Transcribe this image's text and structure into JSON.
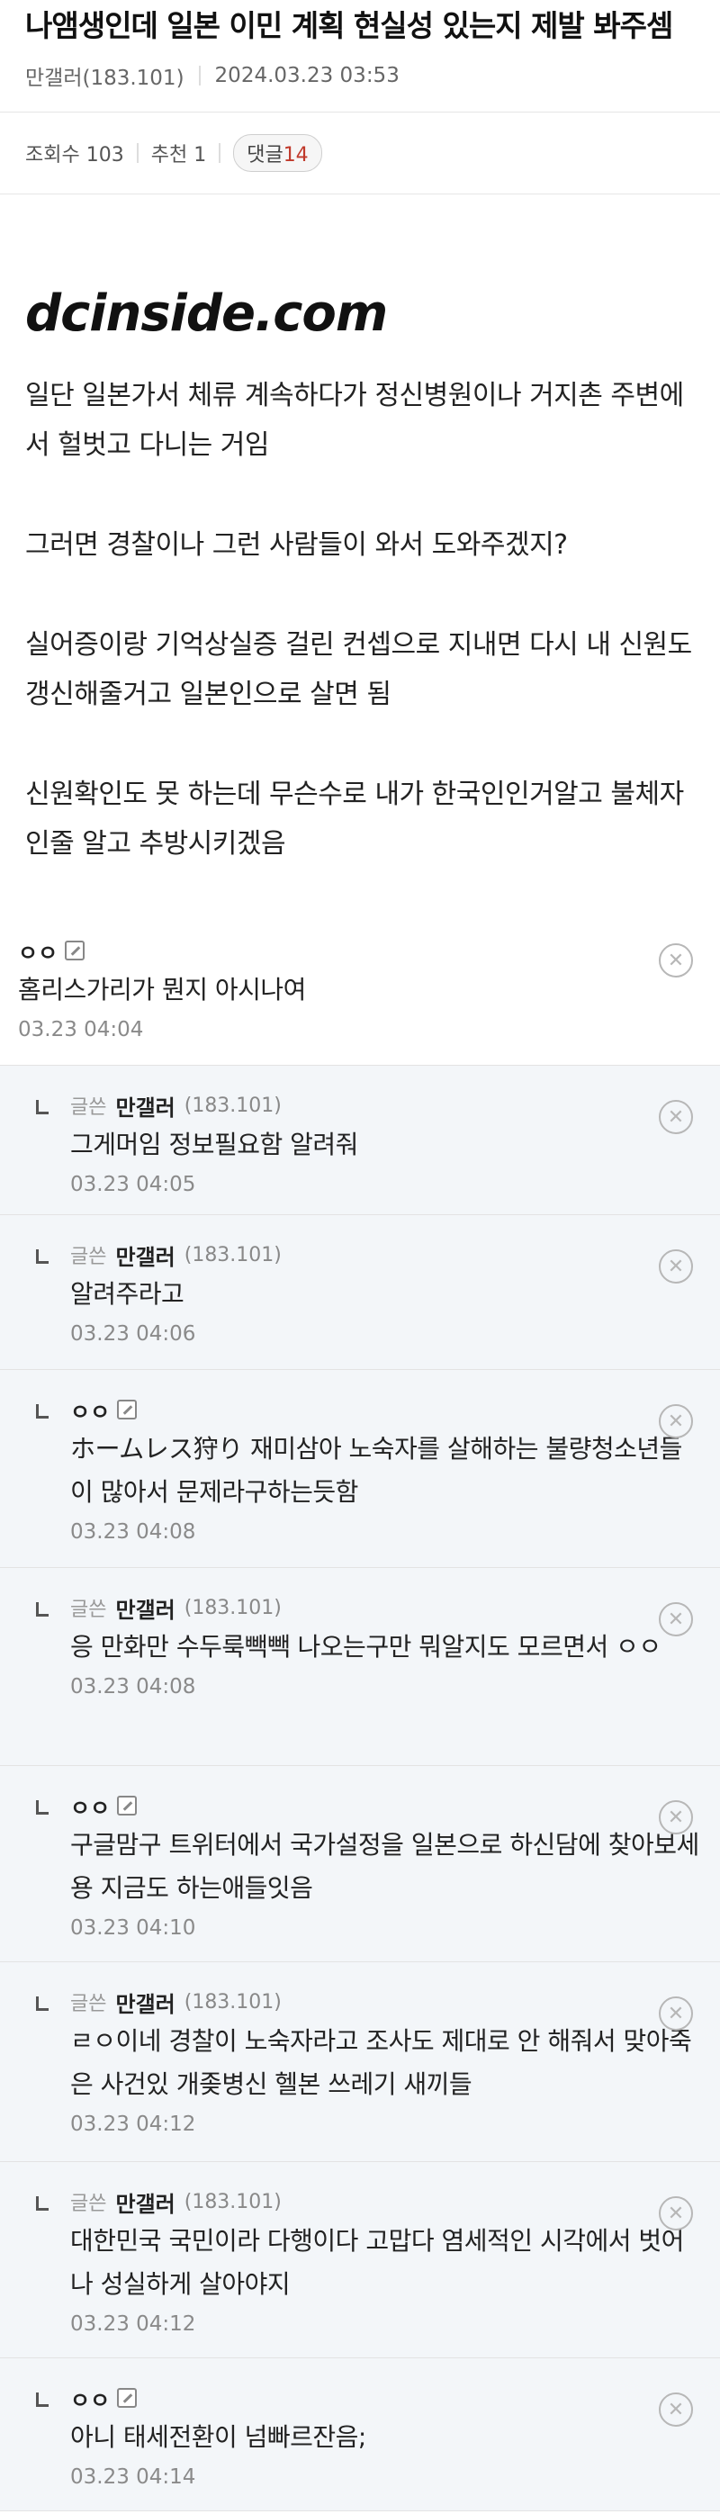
{
  "post": {
    "title": "나앰생인데 일본 이민 계획 현실성 있는지 제발 봐주셈",
    "author": "만갤러(183.101)",
    "date": "2024.03.23 03:53",
    "views_label": "조회수 103",
    "recommend_label": "추천 1",
    "comments_label": "댓글",
    "comments_count": "14",
    "logo_text": "dcinside.com",
    "paragraphs": [
      "일단 일본가서 체류 계속하다가 정신병원이나 거지촌 주변에서 헐벗고 다니는 거임",
      "그러면 경찰이나 그런 사람들이 와서 도와주겠지?",
      "실어증이랑 기억상실증 걸린 컨셉으로 지내면 다시 내 신원도 갱신해줄거고 일본인으로 살면 됨",
      "신원확인도 못 하는데 무슨수로 내가 한국인인거알고 불체자인줄 알고 추방시키겠음"
    ]
  },
  "comments": [
    {
      "nick": "ㅇㅇ",
      "text": "홈리스가리가 뭔지 아시나여",
      "time": "03.23 04:04"
    },
    {
      "tag": "글쓴",
      "nick": "만갤러",
      "ip": "(183.101)",
      "text": "그게머임 정보필요함 알려줘",
      "time": "03.23 04:05"
    },
    {
      "tag": "글쓴",
      "nick": "만갤러",
      "ip": "(183.101)",
      "text": "알려주라고",
      "time": "03.23 04:06"
    },
    {
      "nick": "ㅇㅇ",
      "text": "ホームレス狩り 재미삼아 노숙자를 살해하는 불량청소년들이 많아서 문제라구하는듯함",
      "time": "03.23 04:08"
    },
    {
      "tag": "글쓴",
      "nick": "만갤러",
      "ip": "(183.101)",
      "text": "응 만화만 수두룩빽빽 나오는구만 뭐알지도 모르면서 ㅇㅇ",
      "time": "03.23 04:08"
    },
    {
      "nick": "ㅇㅇ",
      "text": "구글맘구 트위터에서 국가설정을 일본으로 하신담에 찾아보세용 지금도 하는애들잇음",
      "time": "03.23 04:10"
    },
    {
      "tag": "글쓴",
      "nick": "만갤러",
      "ip": "(183.101)",
      "text": "ㄹㅇ이네 경찰이 노숙자라고 조사도 제대로 안 해줘서 맞아죽은 사건있     개좆병신 헬본 쓰레기 새끼들",
      "time": "03.23 04:12"
    },
    {
      "tag": "글쓴",
      "nick": "만갤러",
      "ip": "(183.101)",
      "text": "대한민국 국민이라 다행이다 고맙다 염세적인 시각에서 벗어나 성실하게 살아야지",
      "time": "03.23 04:12"
    },
    {
      "nick": "ㅇㅇ",
      "text": "아니 태세전환이 넘빠르잔음;",
      "time": "03.23 04:14"
    }
  ],
  "icons": {
    "delete": "circle-x-icon",
    "reply": "reply-arrow-icon",
    "edit": "memo-icon"
  }
}
